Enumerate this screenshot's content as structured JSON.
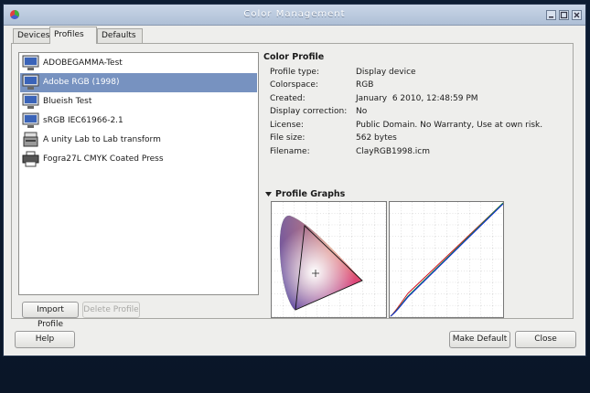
{
  "window": {
    "title": "Color Management"
  },
  "tabs": [
    {
      "label": "Devices"
    },
    {
      "label": "Profiles"
    },
    {
      "label": "Defaults"
    }
  ],
  "profiles": [
    {
      "label": "ADOBEGAMMA-Test",
      "icon": "monitor-icon"
    },
    {
      "label": "Adobe RGB (1998)",
      "icon": "monitor-icon"
    },
    {
      "label": "Blueish Test",
      "icon": "monitor-icon"
    },
    {
      "label": "sRGB IEC61966-2.1",
      "icon": "monitor-icon"
    },
    {
      "label": "A unity Lab to Lab transform",
      "icon": "scanner-icon"
    },
    {
      "label": "Fogra27L CMYK Coated Press",
      "icon": "printer-icon"
    }
  ],
  "list_buttons": {
    "import": "Import Profile",
    "delete": "Delete Profile"
  },
  "color_profile": {
    "heading": "Color Profile",
    "fields": [
      {
        "key": "Profile type:",
        "value": "Display device"
      },
      {
        "key": "Colorspace:",
        "value": "RGB"
      },
      {
        "key": "Created:",
        "value": "January  6 2010, 12:48:59 PM"
      },
      {
        "key": "Display correction:",
        "value": "No"
      },
      {
        "key": "License:",
        "value": "Public Domain. No Warranty, Use at own risk."
      },
      {
        "key": "File size:",
        "value": "562 bytes"
      },
      {
        "key": "Filename:",
        "value": "ClayRGB1998.icm"
      }
    ]
  },
  "graphs": {
    "heading": "Profile Graphs"
  },
  "footer": {
    "help": "Help",
    "make_default": "Make Default",
    "close": "Close"
  },
  "colors": {
    "selection": "#7792c0",
    "curve_red": "#d01020",
    "curve_green": "#10a040",
    "curve_blue": "#1020d0"
  }
}
